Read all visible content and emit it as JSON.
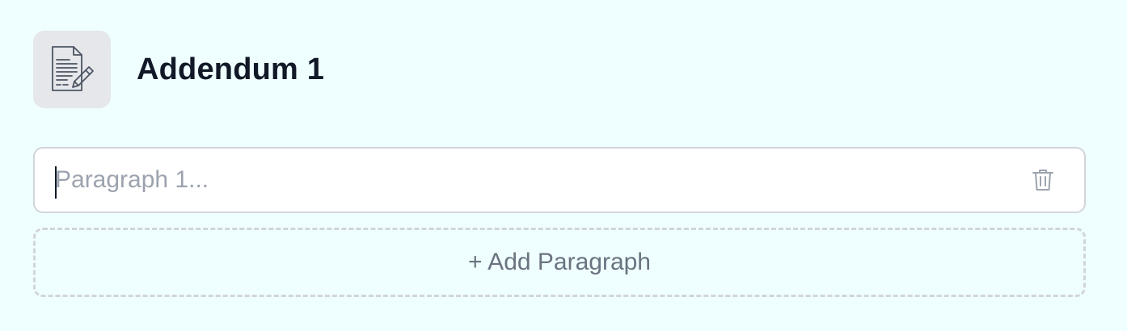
{
  "addendum": {
    "title": "Addendum 1",
    "icon": "document-edit-icon"
  },
  "paragraphs": [
    {
      "value": "",
      "placeholder": "Paragraph 1...",
      "delete_icon": "trash-icon"
    }
  ],
  "actions": {
    "add_paragraph_label": "+ Add Paragraph"
  },
  "colors": {
    "background": "#effefe",
    "icon_box": "#e6e7ea",
    "title": "#111827",
    "placeholder": "#9ca3af",
    "border": "#d1d5db",
    "muted_text": "#6b7280"
  }
}
